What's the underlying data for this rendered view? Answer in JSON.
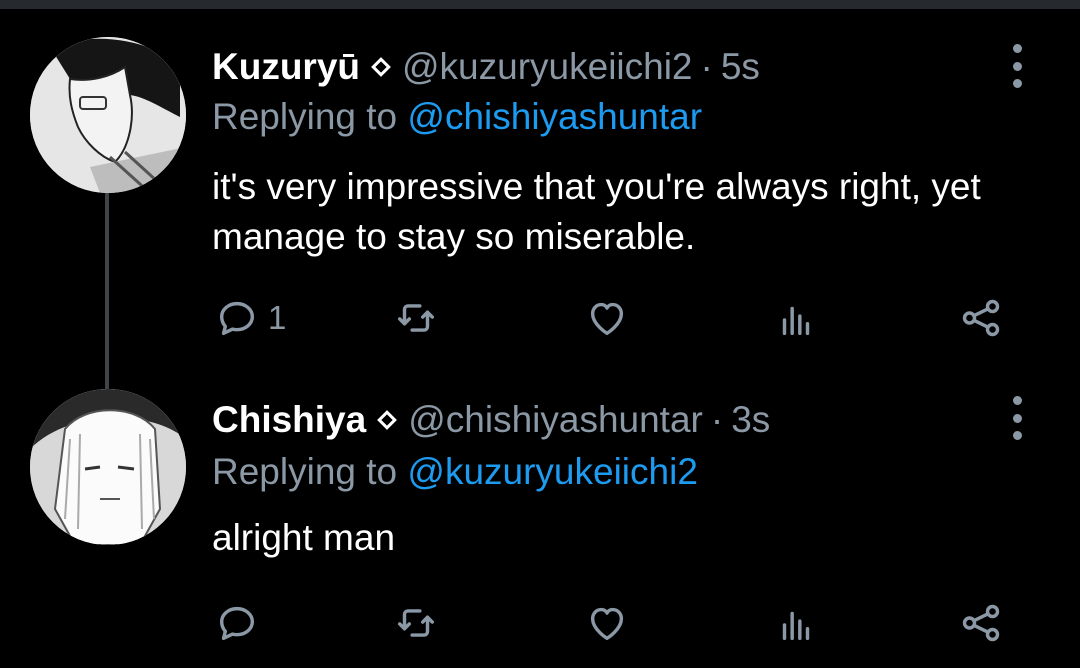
{
  "tweets": [
    {
      "author_name": "Kuzuryū",
      "handle": "@kuzuryukeiichi2",
      "separator": "·",
      "time": "5s",
      "reply_prefix": "Replying to",
      "reply_to": "@chishiyashuntar",
      "text": "it's very impressive that you're always right, yet manage to stay so miserable.",
      "reply_count": "1"
    },
    {
      "author_name": "Chishiya",
      "handle": "@chishiyashuntar",
      "separator": "·",
      "time": "3s",
      "reply_prefix": "Replying to",
      "reply_to": "@kuzuryukeiichi2",
      "text": "alright man",
      "reply_count": ""
    }
  ],
  "icons": [
    "reply-icon",
    "retweet-icon",
    "like-icon",
    "analytics-icon",
    "share-icon",
    "more-options-icon",
    "verified-diamond-icon"
  ],
  "colors": {
    "background": "#000000",
    "link": "#1d9bf0",
    "muted": "#8b98a5",
    "text": "#ffffff"
  }
}
